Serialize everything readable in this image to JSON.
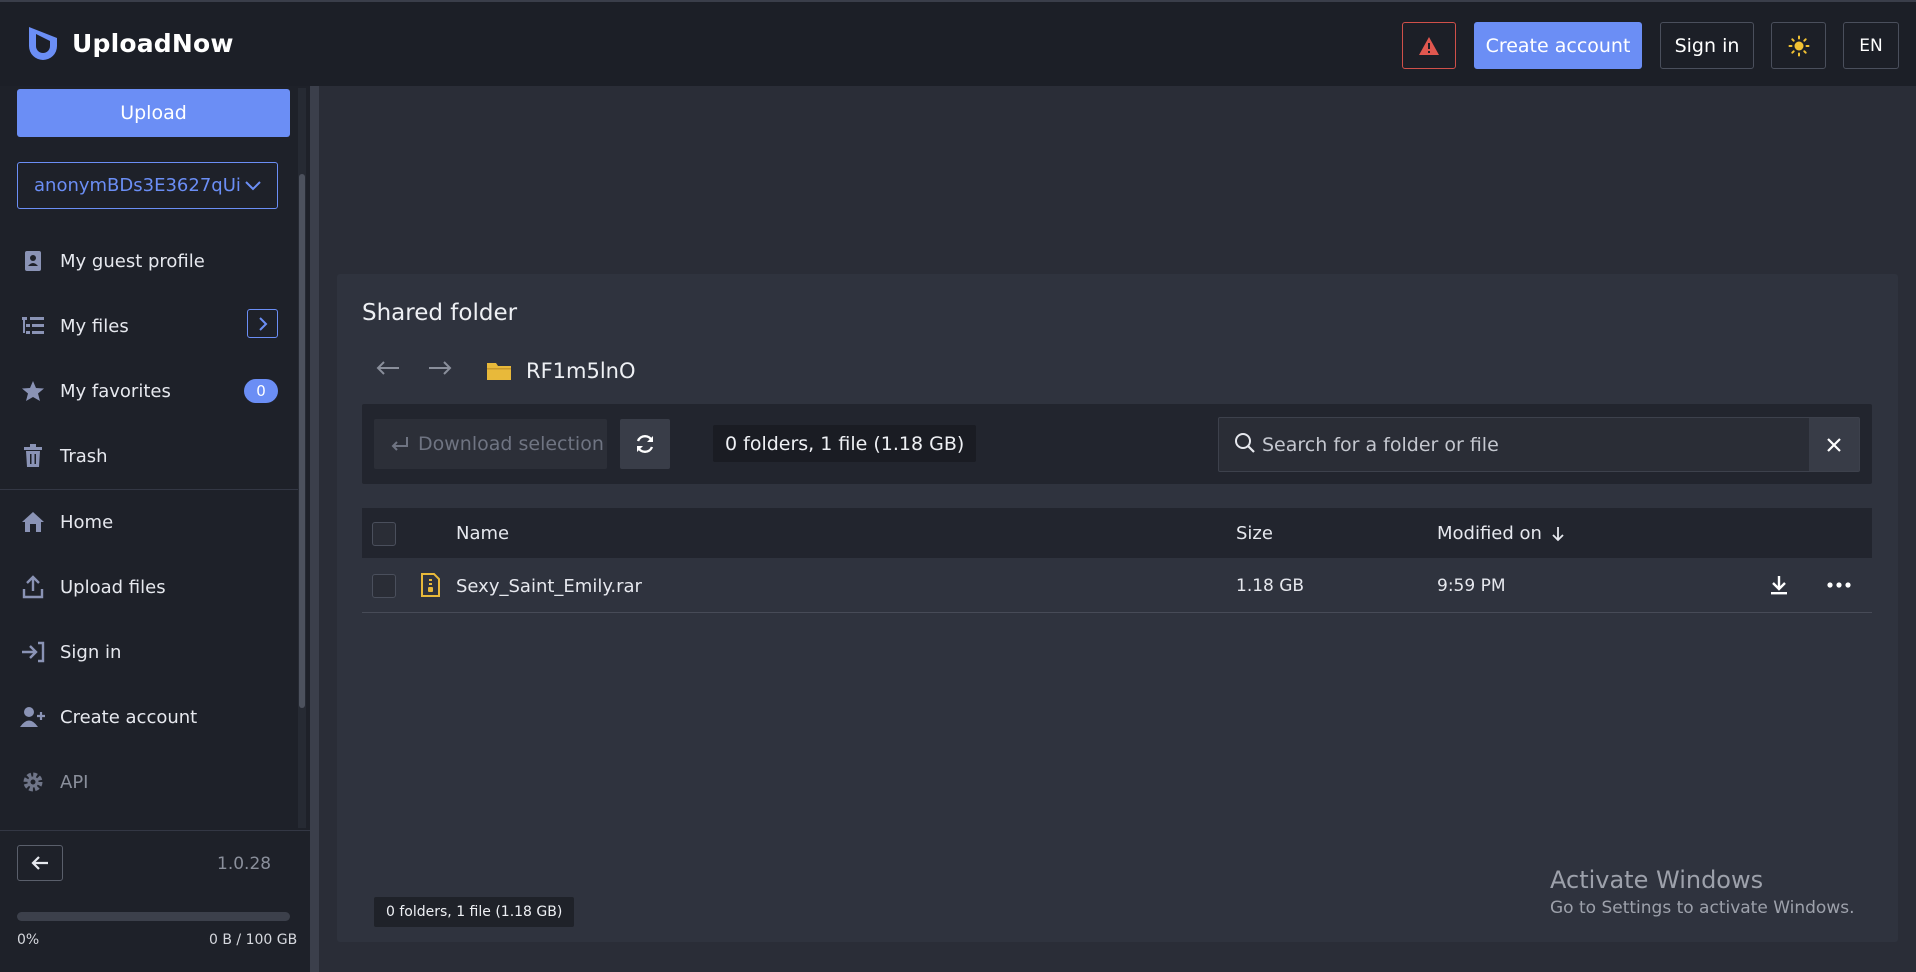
{
  "brand": {
    "name": "UploadNow"
  },
  "header": {
    "create_account": "Create account",
    "sign_in": "Sign in",
    "language": "EN"
  },
  "sidebar": {
    "upload_label": "Upload",
    "account_name": "anonymBDs3E3627qUi",
    "items": [
      {
        "label": "My guest profile",
        "icon": "guest-profile-icon"
      },
      {
        "label": "My files",
        "icon": "file-tree-icon"
      },
      {
        "label": "My favorites",
        "icon": "star-icon",
        "badge": "0"
      },
      {
        "label": "Trash",
        "icon": "trash-icon"
      },
      {
        "label": "Home",
        "icon": "home-icon"
      },
      {
        "label": "Upload files",
        "icon": "upload-icon"
      },
      {
        "label": "Sign in",
        "icon": "sign-in-icon"
      },
      {
        "label": "Create account",
        "icon": "add-user-icon"
      },
      {
        "label": "API",
        "icon": "gear-icon"
      }
    ],
    "version": "1.0.28",
    "storage": {
      "percent_label": "0%",
      "used_fraction": 0.0,
      "amount_label": "0 B / 100 GB"
    }
  },
  "main": {
    "title": "Shared folder",
    "folder_name": "RF1m5lnO",
    "download_selection": "Download selection",
    "counts": "0 folders, 1 file (1.18 GB)",
    "search_placeholder": "Search for a folder or file",
    "columns": {
      "name": "Name",
      "size": "Size",
      "modified": "Modified on"
    },
    "rows": [
      {
        "name": "Sexy_Saint_Emily.rar",
        "size": "1.18 GB",
        "modified": "9:59 PM"
      }
    ],
    "footer_counts": "0 folders, 1 file (1.18 GB)"
  },
  "watermark": {
    "title": "Activate Windows",
    "subtitle": "Go to Settings to activate Windows."
  },
  "colors": {
    "accent": "#6b8ef5",
    "danger": "#d0504a",
    "file": "#e8b93a",
    "folder": "#e8b93a"
  }
}
